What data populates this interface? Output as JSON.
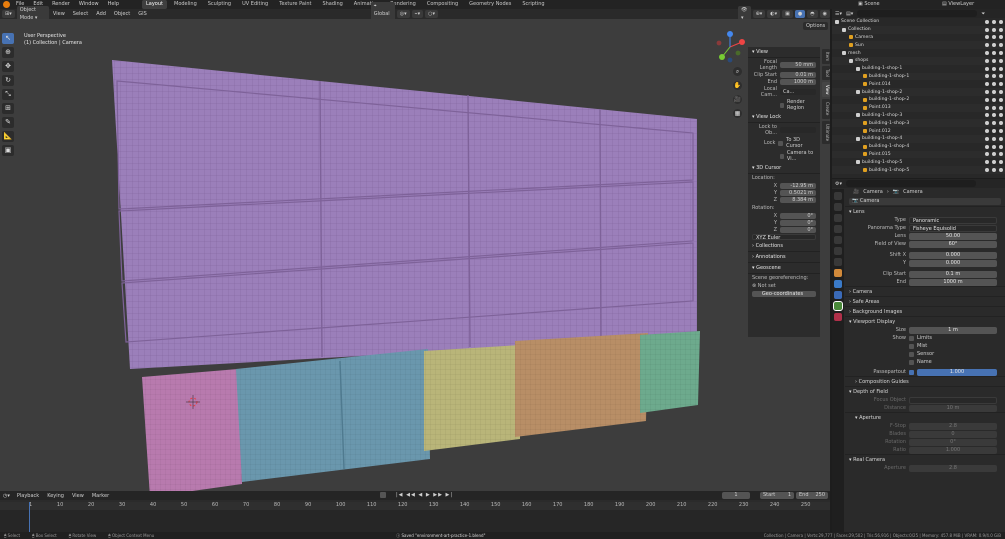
{
  "menu": {
    "items": [
      "File",
      "Edit",
      "Render",
      "Window",
      "Help"
    ]
  },
  "workspaces": [
    {
      "label": "Layout",
      "active": true
    },
    {
      "label": "Modeling"
    },
    {
      "label": "Sculpting"
    },
    {
      "label": "UV Editing"
    },
    {
      "label": "Texture Paint"
    },
    {
      "label": "Shading"
    },
    {
      "label": "Animation"
    },
    {
      "label": "Rendering"
    },
    {
      "label": "Compositing"
    },
    {
      "label": "Geometry Nodes"
    },
    {
      "label": "Scripting"
    }
  ],
  "scene": {
    "name": "Scene",
    "view_layer": "ViewLayer"
  },
  "viewport_header": {
    "mode": "Object Mode",
    "menus": [
      "View",
      "Select",
      "Add",
      "Object",
      "GIS"
    ],
    "orientation": "Global",
    "options_label": "Options"
  },
  "viewport": {
    "perspective": "User Perspective",
    "collection_info": "(1) Collection | Camera"
  },
  "npanel": {
    "tabs": [
      "Item",
      "Tool",
      "View",
      "Create",
      "Ultimate"
    ],
    "view_header": "View",
    "focal_length_label": "Focal Length",
    "focal_length": "50 mm",
    "clip_start_label": "Clip Start",
    "clip_start": "0.01 m",
    "end_label": "End",
    "clip_end": "1000 m",
    "local_camera_label": "Local Cam...",
    "local_camera_value": "Ca...",
    "render_region_label": "Render Region",
    "view_lock_header": "View Lock",
    "lock_to_object_label": "Lock to Ob...",
    "lock_label": "Lock",
    "to_3d_cursor": "To 3D Cursor",
    "camera_to_view": "Camera to Vi...",
    "cursor_header": "3D Cursor",
    "location_label": "Location:",
    "loc_x": "-12.95 m",
    "loc_y": "0.5021 m",
    "loc_z": "8.384 m",
    "rotation_label": "Rotation:",
    "rot_x": "0°",
    "rot_y": "0°",
    "rot_z": "0°",
    "rotation_mode": "XYZ Euler",
    "collections": "Collections",
    "annotations": "Annotations",
    "geoscene": "Geoscene",
    "scene_georef_label": "Scene georeferencing:",
    "not_set": "Not set",
    "geo_coords": "Geo-coordinates"
  },
  "outliner": {
    "rows": [
      {
        "label": "Scene Collection",
        "indent": 0,
        "icon_color": "#cfcfcf"
      },
      {
        "label": "Collection",
        "indent": 1,
        "icon_color": "#cfcfcf"
      },
      {
        "label": "Camera",
        "indent": 2,
        "icon_color": "#e0a020"
      },
      {
        "label": "Sun",
        "indent": 2,
        "icon_color": "#e0a020"
      },
      {
        "label": "mesh",
        "indent": 1,
        "icon_color": "#cfcfcf"
      },
      {
        "label": "shops",
        "indent": 2,
        "icon_color": "#cfcfcf"
      },
      {
        "label": "building-1-shop-1",
        "indent": 3,
        "icon_color": "#cfcfcf"
      },
      {
        "label": "building-1-shop-1",
        "indent": 4,
        "icon_color": "#e0a020"
      },
      {
        "label": "Point.014",
        "indent": 4,
        "icon_color": "#e0a020"
      },
      {
        "label": "building-1-shop-2",
        "indent": 3,
        "icon_color": "#cfcfcf"
      },
      {
        "label": "building-1-shop-2",
        "indent": 4,
        "icon_color": "#e0a020"
      },
      {
        "label": "Point.013",
        "indent": 4,
        "icon_color": "#e0a020"
      },
      {
        "label": "building-1-shop-3",
        "indent": 3,
        "icon_color": "#cfcfcf"
      },
      {
        "label": "building-1-shop-3",
        "indent": 4,
        "icon_color": "#e0a020"
      },
      {
        "label": "Point.012",
        "indent": 4,
        "icon_color": "#e0a020"
      },
      {
        "label": "building-1-shop-4",
        "indent": 3,
        "icon_color": "#cfcfcf"
      },
      {
        "label": "building-1-shop-4",
        "indent": 4,
        "icon_color": "#e0a020"
      },
      {
        "label": "Point.015",
        "indent": 4,
        "icon_color": "#e0a020"
      },
      {
        "label": "building-1-shop-5",
        "indent": 3,
        "icon_color": "#cfcfcf"
      },
      {
        "label": "building-1-shop-5",
        "indent": 4,
        "icon_color": "#e0a020"
      }
    ]
  },
  "properties": {
    "breadcrumb_obj": "Camera",
    "breadcrumb_data": "Camera",
    "datablock": "Camera",
    "lens_header": "Lens",
    "type_label": "Type",
    "type_value": "Panoramic",
    "pano_type_label": "Panorama Type",
    "pano_type_value": "Fisheye Equisolid",
    "lens_label": "Lens",
    "lens_value": "50.00",
    "fov_label": "Field of View",
    "fov_value": "60°",
    "shift_x_label": "Shift X",
    "shift_x_value": "0.000",
    "shift_y_label": "Y",
    "shift_y_value": "0.000",
    "clip_start_label": "Clip Start",
    "clip_start_value": "0.1 m",
    "clip_end_label": "End",
    "clip_end_value": "1000 m",
    "camera_header": "Camera",
    "safe_areas_header": "Safe Areas",
    "bg_images_header": "Background Images",
    "viewport_display_header": "Viewport Display",
    "size_label": "Size",
    "size_value": "1 m",
    "show_label": "Show",
    "show_items": [
      "Limits",
      "Mist",
      "Sensor",
      "Name"
    ],
    "passepartout_label": "Passepartout",
    "passepartout_value": "1.000",
    "composition_guides": "Composition Guides",
    "dof_header": "Depth of Field",
    "focus_object_label": "Focus Object",
    "distance_label": "Distance",
    "distance_value": "10 m",
    "aperture_header": "Aperture",
    "fstop_label": "F-Stop",
    "fstop_value": "2.8",
    "blades_label": "Blades",
    "blades_value": "0",
    "rotation_label": "Rotation",
    "rotation_value": "0°",
    "ratio_label": "Ratio",
    "ratio_value": "1.000",
    "real_camera_header": "Real Camera",
    "aperture_label": "Aperture",
    "aperture_value": "2.8"
  },
  "timeline": {
    "menus": [
      "Playback",
      "Keying",
      "View",
      "Marker"
    ],
    "current_frame": "1",
    "start_label": "Start",
    "start": "1",
    "end_label": "End",
    "end": "250",
    "ticks": [
      "1",
      "10",
      "20",
      "30",
      "40",
      "50",
      "60",
      "70",
      "80",
      "90",
      "100",
      "110",
      "120",
      "130",
      "140",
      "150",
      "160",
      "170",
      "180",
      "190",
      "200",
      "210",
      "220",
      "230",
      "240",
      "250"
    ]
  },
  "status": {
    "select": "Select",
    "box_select": "Box Select",
    "rotate_view": "Rotate View",
    "context_menu": "Object Context Menu",
    "saved": "Saved \"environment-art-practice-1.blend\"",
    "info": "Collection | Camera | Verts:29,777 | Faces:29,502 | Tris:56,916 | Objects:0/25 | Memory: 457.8 MiB | VRAM: 0.9/4.0 GiB"
  }
}
